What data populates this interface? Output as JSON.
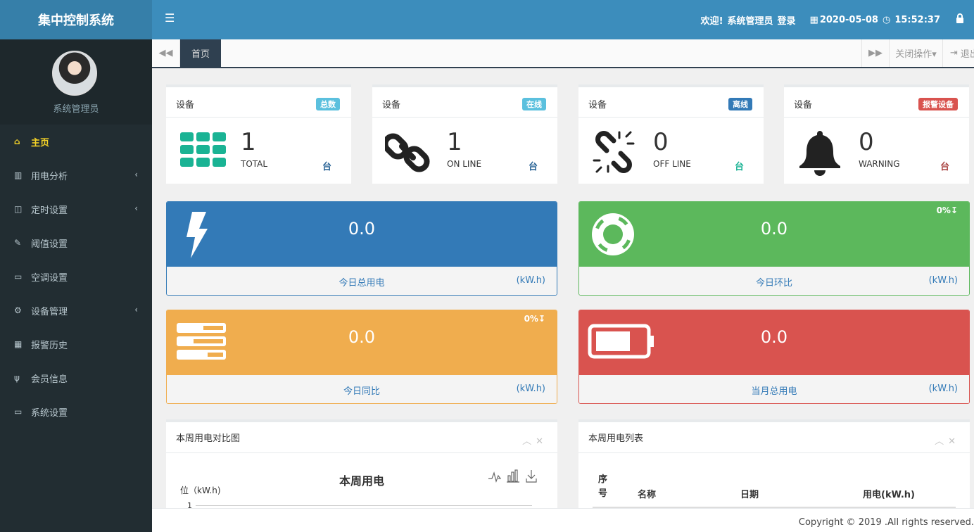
{
  "brand": {
    "title": "集中控制系统"
  },
  "header": {
    "menu_icon": "bars-icon",
    "welcome": "欢迎!",
    "user": "系统管理员",
    "login": "登录",
    "date": "2020-05-08",
    "time": "15:52:37"
  },
  "sidebar": {
    "user_name": "系统管理员",
    "items": [
      {
        "label": "主页",
        "icon": "home-icon",
        "active": true
      },
      {
        "label": "用电分析",
        "icon": "bar-chart-icon",
        "arrow": true
      },
      {
        "label": "定时设置",
        "icon": "columns-icon",
        "arrow": true
      },
      {
        "label": "阈值设置",
        "icon": "edit-icon"
      },
      {
        "label": "空调设置",
        "icon": "battery-icon"
      },
      {
        "label": "设备管理",
        "icon": "gear-icon",
        "arrow": true
      },
      {
        "label": "报警历史",
        "icon": "table-icon"
      },
      {
        "label": "会员信息",
        "icon": "cutlery-icon"
      },
      {
        "label": "系统设置",
        "icon": "desktop-icon"
      }
    ]
  },
  "tabs": {
    "home": "首页",
    "close_ops": "关闭操作▾",
    "exit": "退出"
  },
  "stats": [
    {
      "title": "设备",
      "badge": "总数",
      "badge_color": "#5bc0de",
      "value": "1",
      "sub": "TOTAL",
      "unit": "台",
      "unit_color": "#2a6496",
      "icon": "grid-icon"
    },
    {
      "title": "设备",
      "badge": "在线",
      "badge_color": "#5bc0de",
      "value": "1",
      "sub": "ON LINE",
      "unit": "台",
      "unit_color": "#2a6496",
      "icon": "link-icon"
    },
    {
      "title": "设备",
      "badge": "离线",
      "badge_color": "#337ab7",
      "value": "0",
      "sub": "OFF LINE",
      "unit": "台",
      "unit_color": "#1ab394",
      "icon": "unlink-icon"
    },
    {
      "title": "设备",
      "badge": "报警设备",
      "badge_color": "#d9534f",
      "value": "0",
      "sub": "WARNING",
      "unit": "台",
      "unit_color": "#a94442",
      "icon": "bell-icon"
    }
  ],
  "cards": [
    {
      "value": "0.0",
      "label": "今日总用电",
      "unit": "(kW.h)",
      "pct": "",
      "color": "#337ab7",
      "icon": "bolt-icon"
    },
    {
      "value": "0.0",
      "label": "今日环比",
      "unit": "(kW.h)",
      "pct": "0%↧",
      "color": "#5cb85c",
      "icon": "life-ring-icon"
    },
    {
      "value": "0.0",
      "label": "今日同比",
      "unit": "(kW.h)",
      "pct": "0%↧",
      "color": "#f0ad4e",
      "icon": "tasks-icon"
    },
    {
      "value": "0.0",
      "label": "当月总用电",
      "unit": "(kW.h)",
      "pct": "",
      "color": "#d9534f",
      "icon": "battery-icon"
    }
  ],
  "chart_panel": {
    "title": "本周用电对比图",
    "chart_title": "本周用电",
    "ylabel": "位（kW.h)",
    "tick": "1"
  },
  "chart_data": {
    "type": "bar",
    "title": "本周用电",
    "ylabel": "位（kW.h)",
    "categories": [],
    "values": []
  },
  "list_panel": {
    "title": "本周用电列表",
    "col_index": "序\n号",
    "col_name": "名称",
    "col_date": "日期",
    "col_power": "用电(kW.h)"
  },
  "footer": {
    "text": "Copyright © 2019 .All rights reserved."
  }
}
